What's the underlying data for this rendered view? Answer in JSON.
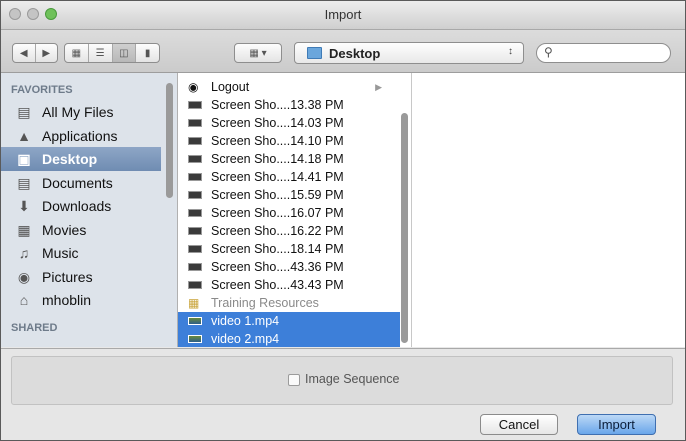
{
  "window": {
    "title": "Import"
  },
  "toolbar": {
    "location": "Desktop",
    "location_arrow": "↕",
    "search_placeholder": ""
  },
  "sidebar": {
    "favorites_header": "FAVORITES",
    "shared_header": "SHARED",
    "items": [
      {
        "label": "All My Files",
        "icon": "all-files-icon",
        "selected": false
      },
      {
        "label": "Applications",
        "icon": "applications-icon",
        "selected": false
      },
      {
        "label": "Desktop",
        "icon": "desktop-icon",
        "selected": true
      },
      {
        "label": "Documents",
        "icon": "documents-icon",
        "selected": false
      },
      {
        "label": "Downloads",
        "icon": "downloads-icon",
        "selected": false
      },
      {
        "label": "Movies",
        "icon": "movies-icon",
        "selected": false
      },
      {
        "label": "Music",
        "icon": "music-icon",
        "selected": false
      },
      {
        "label": "Pictures",
        "icon": "pictures-icon",
        "selected": false
      },
      {
        "label": "mhoblin",
        "icon": "home-icon",
        "selected": false
      }
    ]
  },
  "files": [
    {
      "name": "Logout",
      "kind": "app",
      "selected": false
    },
    {
      "name": "Screen Sho....13.38 PM",
      "kind": "image",
      "selected": false
    },
    {
      "name": "Screen Sho....14.03 PM",
      "kind": "image",
      "selected": false
    },
    {
      "name": "Screen Sho....14.10 PM",
      "kind": "image",
      "selected": false
    },
    {
      "name": "Screen Sho....14.18 PM",
      "kind": "image",
      "selected": false
    },
    {
      "name": "Screen Sho....14.41 PM",
      "kind": "image",
      "selected": false
    },
    {
      "name": "Screen Sho....15.59 PM",
      "kind": "image",
      "selected": false
    },
    {
      "name": "Screen Sho....16.07 PM",
      "kind": "image",
      "selected": false
    },
    {
      "name": "Screen Sho....16.22 PM",
      "kind": "image",
      "selected": false
    },
    {
      "name": "Screen Sho....18.14 PM",
      "kind": "image",
      "selected": false
    },
    {
      "name": "Screen Sho....43.36 PM",
      "kind": "image",
      "selected": false
    },
    {
      "name": "Screen Sho....43.43 PM",
      "kind": "image",
      "selected": false
    },
    {
      "name": "Training Resources",
      "kind": "disabled",
      "selected": false
    },
    {
      "name": "video 1.mp4",
      "kind": "video",
      "selected": true
    },
    {
      "name": "video 2.mp4",
      "kind": "video",
      "selected": true
    }
  ],
  "options": {
    "image_sequence_label": "Image Sequence"
  },
  "buttons": {
    "cancel": "Cancel",
    "import": "Import"
  },
  "colors": {
    "selection": "#3d7fd9",
    "sidebar_bg": "#dde3ea",
    "default_button": "#6aa6ea"
  }
}
